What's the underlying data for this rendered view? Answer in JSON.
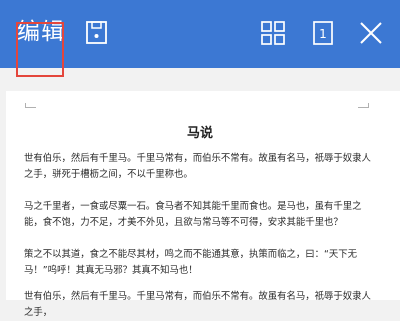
{
  "toolbar": {
    "edit_label": "编辑",
    "page_number": "1",
    "icons": [
      "save-icon",
      "grid-view-icon",
      "page-count-icon",
      "close-icon"
    ],
    "background_color": "#3c78d3",
    "highlight_color": "#e4463c"
  },
  "document": {
    "title": "马说",
    "paragraphs": [
      "世有伯乐，然后有千里马。千里马常有，而伯乐不常有。故虽有名马，祇辱于奴隶人之手，骈死于槽枥之间，不以千里称也。",
      "马之千里者，一食或尽粟一石。食马者不知其能千里而食也。是马也，虽有千里之能，食不饱，力不足，才美不外见，且欲与常马等不可得，安求其能千里也？",
      "策之不以其道，食之不能尽其材，鸣之而不能通其意，执策而临之，曰：“天下无马！”呜呼！其真无马邪？其真不知马也！",
      "世有伯乐，然后有千里马。千里马常有，而伯乐不常有。故虽有名马，祇辱于奴隶人之手，"
    ]
  }
}
